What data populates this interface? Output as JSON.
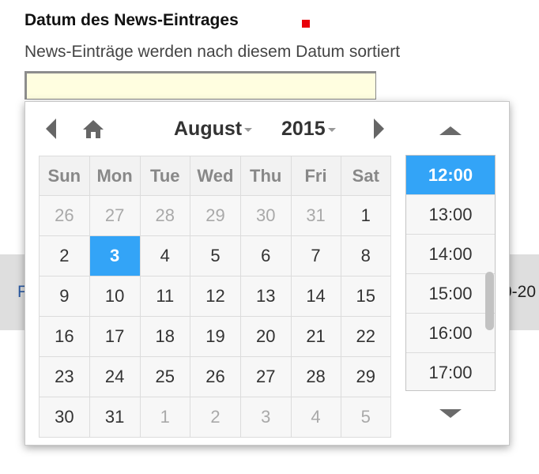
{
  "field": {
    "title": "Datum des News-Eintrages",
    "description": "News-Einträge werden nach diesem Datum sortiert",
    "value": ""
  },
  "background": {
    "left_text": "F",
    "right_text": "0-20"
  },
  "picker": {
    "month": "August",
    "year": "2015",
    "weekdays": [
      "Sun",
      "Mon",
      "Tue",
      "Wed",
      "Thu",
      "Fri",
      "Sat"
    ],
    "weeks": [
      [
        {
          "d": "26",
          "o": true
        },
        {
          "d": "27",
          "o": true
        },
        {
          "d": "28",
          "o": true
        },
        {
          "d": "29",
          "o": true
        },
        {
          "d": "30",
          "o": true
        },
        {
          "d": "31",
          "o": true
        },
        {
          "d": "1"
        }
      ],
      [
        {
          "d": "2"
        },
        {
          "d": "3",
          "s": true
        },
        {
          "d": "4"
        },
        {
          "d": "5"
        },
        {
          "d": "6"
        },
        {
          "d": "7"
        },
        {
          "d": "8"
        }
      ],
      [
        {
          "d": "9"
        },
        {
          "d": "10"
        },
        {
          "d": "11"
        },
        {
          "d": "12"
        },
        {
          "d": "13"
        },
        {
          "d": "14"
        },
        {
          "d": "15"
        }
      ],
      [
        {
          "d": "16"
        },
        {
          "d": "17"
        },
        {
          "d": "18"
        },
        {
          "d": "19"
        },
        {
          "d": "20"
        },
        {
          "d": "21"
        },
        {
          "d": "22"
        }
      ],
      [
        {
          "d": "23"
        },
        {
          "d": "24"
        },
        {
          "d": "25"
        },
        {
          "d": "26"
        },
        {
          "d": "27"
        },
        {
          "d": "28"
        },
        {
          "d": "29"
        }
      ],
      [
        {
          "d": "30"
        },
        {
          "d": "31"
        },
        {
          "d": "1",
          "o": true
        },
        {
          "d": "2",
          "o": true
        },
        {
          "d": "3",
          "o": true
        },
        {
          "d": "4",
          "o": true
        },
        {
          "d": "5",
          "o": true
        }
      ]
    ],
    "times": [
      "12:00",
      "13:00",
      "14:00",
      "15:00",
      "16:00",
      "17:00"
    ],
    "selected_time": "12:00"
  },
  "colors": {
    "accent": "#33a4f7",
    "required": "#e8000b",
    "input_bg": "#fffee0"
  }
}
